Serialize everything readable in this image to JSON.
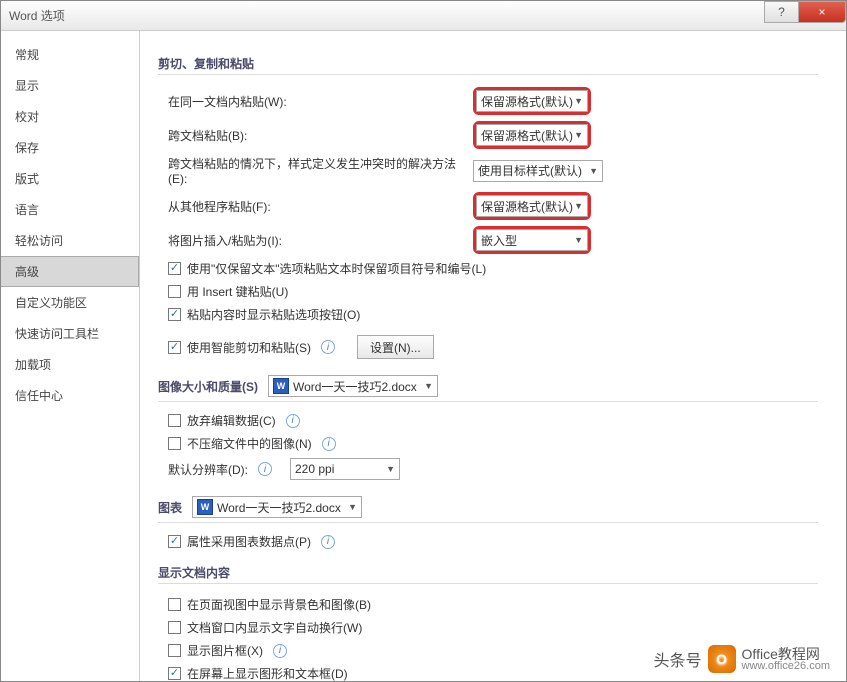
{
  "window": {
    "title": "Word 选项"
  },
  "titlebar": {
    "help": "?",
    "close": "×"
  },
  "sidebar": {
    "items": [
      "常规",
      "显示",
      "校对",
      "保存",
      "版式",
      "语言",
      "轻松访问",
      "高级",
      "自定义功能区",
      "快速访问工具栏",
      "加载项",
      "信任中心"
    ],
    "selected_index": 7
  },
  "section_paste": {
    "title": "剪切、复制和粘贴",
    "rows": {
      "same_doc": {
        "label": "在同一文档内粘贴(W):",
        "value": "保留源格式(默认)"
      },
      "cross_doc": {
        "label": "跨文档粘贴(B):",
        "value": "保留源格式(默认)"
      },
      "cross_doc_conflict": {
        "label": "跨文档粘贴的情况下，样式定义发生冲突时的解决方法(E):",
        "value": "使用目标样式(默认)"
      },
      "other_app": {
        "label": "从其他程序粘贴(F):",
        "value": "保留源格式(默认)"
      },
      "insert_pic": {
        "label": "将图片插入/粘贴为(I):",
        "value": "嵌入型"
      }
    },
    "checkboxes": {
      "keep_bullets": {
        "label": "使用\"仅保留文本\"选项粘贴文本时保留项目符号和编号(L)",
        "checked": true
      },
      "insert_key": {
        "label": "用 Insert 键粘贴(U)",
        "checked": false
      },
      "show_paste_options": {
        "label": "粘贴内容时显示粘贴选项按钮(O)",
        "checked": true
      },
      "smart_cut": {
        "label": "使用智能剪切和粘贴(S)",
        "checked": true
      }
    },
    "settings_btn": "设置(N)..."
  },
  "section_image": {
    "title": "图像大小和质量(S)",
    "doc_name": "Word一天一技巧2.docx",
    "checkboxes": {
      "discard_edit": {
        "label": "放弃编辑数据(C)",
        "checked": false
      },
      "no_compress": {
        "label": "不压缩文件中的图像(N)",
        "checked": false
      }
    },
    "ppi_label": "默认分辨率(D):",
    "ppi_value": "220 ppi"
  },
  "section_chart": {
    "title": "图表",
    "doc_name": "Word一天一技巧2.docx",
    "chk_props": {
      "label": "属性采用图表数据点(P)",
      "checked": true
    }
  },
  "section_display": {
    "title": "显示文档内容",
    "checkboxes": {
      "bg_colors": {
        "label": "在页面视图中显示背景色和图像(B)",
        "checked": false
      },
      "text_wrap": {
        "label": "文档窗口内显示文字自动换行(W)",
        "checked": false
      },
      "pic_frame": {
        "label": "显示图片框(X)",
        "checked": false
      },
      "draw_shapes": {
        "label": "在屏幕上显示图形和文本框(D)",
        "checked": true
      }
    }
  },
  "watermark": {
    "brand_cn": "Office教程网",
    "brand_sub": "头条号",
    "url": "www.office26.com"
  },
  "icons": {
    "info": "i",
    "word": "W"
  }
}
